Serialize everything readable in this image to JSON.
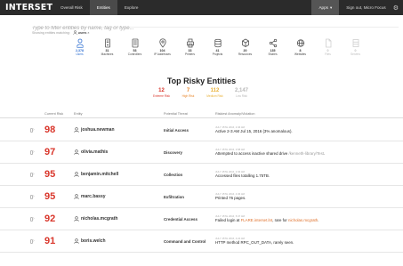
{
  "app": {
    "logo": "INTERSET",
    "nav": [
      "Overall Risk",
      "Entities",
      "Explore"
    ],
    "apps_label": "Apps",
    "apps_caret": "▾",
    "signout": "Sign out, Micro Focus",
    "settings_glyph": "⚙"
  },
  "search": {
    "placeholder": "Type to filter entities by name, tag or type..."
  },
  "filters": {
    "label": "Showing entities matching:",
    "chip_label": "users",
    "chip_remove": "×"
  },
  "entity_types": [
    {
      "icon": "users-icon",
      "count": "2,378",
      "label": "Users",
      "state": "active"
    },
    {
      "icon": "machines-icon",
      "count": "31",
      "label": "Machines",
      "state": "normal"
    },
    {
      "icon": "controllers-icon",
      "count": "53",
      "label": "Controllers",
      "state": "normal"
    },
    {
      "icon": "ip-address-icon",
      "count": "104",
      "label": "IP Addresses",
      "state": "normal"
    },
    {
      "icon": "printers-icon",
      "count": "33",
      "label": "Printers",
      "state": "normal"
    },
    {
      "icon": "projects-icon",
      "count": "41",
      "label": "Projects",
      "state": "normal"
    },
    {
      "icon": "resources-icon",
      "count": "20",
      "label": "Resources",
      "state": "normal"
    },
    {
      "icon": "shares-icon",
      "count": "135",
      "label": "Shares",
      "state": "normal"
    },
    {
      "icon": "websites-icon",
      "count": "8",
      "label": "Websites",
      "state": "normal"
    },
    {
      "icon": "files-icon",
      "count": "0",
      "label": "Files",
      "state": "dim"
    },
    {
      "icon": "servers-icon",
      "count": "0",
      "label": "Servers",
      "state": "dim"
    }
  ],
  "heading": "Top Risky Entities",
  "stats": [
    {
      "value": "12",
      "label": "Extreme Risk",
      "color": "#d9362b"
    },
    {
      "value": "7",
      "label": "High Risk",
      "color": "#e8862a"
    },
    {
      "value": "112",
      "label": "Medium Risk",
      "color": "#e9b23a"
    },
    {
      "value": "2,147",
      "label": "Low Risk",
      "color": "#b8b8b8"
    }
  ],
  "table": {
    "headers": {
      "current_risk": "Current Risk",
      "entity": "Entity",
      "threat": "Potential Threat",
      "anomaly": "Riskiest Anomaly/Violation"
    },
    "rows": [
      {
        "risk": "98",
        "entity": "joshua.newman",
        "threat": "Initial Access",
        "ts": "JULY 15TH 2016, 2:46 AM",
        "desc": [
          {
            "t": "Active 2-3 AM Jul 15, 2016 (3% anomalous).",
            "s": "n"
          }
        ]
      },
      {
        "risk": "97",
        "entity": "olivia.mathis",
        "threat": "Discovery",
        "ts": "JULY 15TH 2016, 2:58 AM",
        "desc": [
          {
            "t": "Attempted to access inactive shared drive ",
            "s": "n"
          },
          {
            "t": "/kenneth-library/Test",
            "s": "m"
          },
          {
            "t": ".",
            "s": "n"
          }
        ]
      },
      {
        "risk": "95",
        "entity": "benjamin.mitchell",
        "threat": "Collection",
        "ts": "JULY 15TH 2016, 2:46 AM",
        "desc": [
          {
            "t": "Accessed files totalling 1.75TB.",
            "s": "n"
          }
        ]
      },
      {
        "risk": "95",
        "entity": "marc.bassy",
        "threat": "Exfiltration",
        "ts": "JULY 15TH 2016, 4:36 AM",
        "desc": [
          {
            "t": "Printed 76 pages.",
            "s": "n"
          }
        ]
      },
      {
        "risk": "92",
        "entity": "nicholas.mcgrath",
        "threat": "Credential Access",
        "ts": "JULY 15TH 2016, 5:47 AM",
        "desc": [
          {
            "t": "Failed login at ",
            "s": "n"
          },
          {
            "t": "FLARE.interset.lnt",
            "s": "h"
          },
          {
            "t": ", rare for ",
            "s": "n"
          },
          {
            "t": "nicholas.mcgrath",
            "s": "h"
          },
          {
            "t": ".",
            "s": "n"
          }
        ]
      },
      {
        "risk": "91",
        "entity": "boris.welch",
        "threat": "Command and Control",
        "ts": "JULY 15TH 2016, 4:24 AM",
        "desc": [
          {
            "t": "HTTP method RPC_OUT_DATA, rarely seen.",
            "s": "n"
          }
        ]
      }
    ]
  },
  "colors": {
    "risk": "#d9362b",
    "accent": "#2f6fd1",
    "highlight": "#e0702a"
  }
}
